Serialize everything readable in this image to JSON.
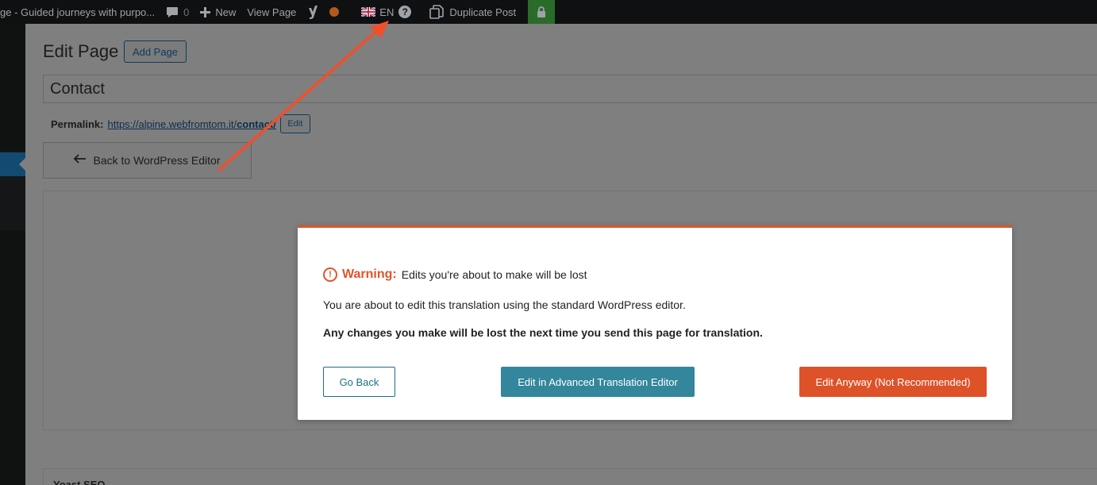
{
  "adminbar": {
    "site_title": "ge - Guided journeys with purpo...",
    "comments_count": "0",
    "new_label": "New",
    "view_page_label": "View Page",
    "language_label": "EN",
    "help_glyph": "?",
    "duplicate_label": "Duplicate Post"
  },
  "page": {
    "heading": "Edit Page",
    "add_page_label": "Add Page",
    "title_value": "Contact",
    "permalink_label": "Permalink:",
    "permalink_base": "https://alpine.webfromtom.it/",
    "permalink_slug": "contact/",
    "permalink_edit_label": "Edit",
    "back_button_label": "Back to WordPress Editor",
    "metabox_title": "Yoast SEO"
  },
  "modal": {
    "warning_glyph": "!",
    "warning_label": "Warning:",
    "warning_text": "Edits you're about to make will be lost",
    "paragraph_1": "You are about to edit this translation using the standard WordPress editor.",
    "paragraph_2": "Any changes you make will be lost the next time you send this page for translation.",
    "go_back_label": "Go Back",
    "advanced_editor_label": "Edit in Advanced Translation Editor",
    "edit_anyway_label": "Edit Anyway (Not Recommended)"
  },
  "colors": {
    "warning_orange": "#e0542a",
    "primary_teal": "#33869b",
    "danger_orange": "#dd5229",
    "annotation_arrow": "#f24e2a"
  }
}
